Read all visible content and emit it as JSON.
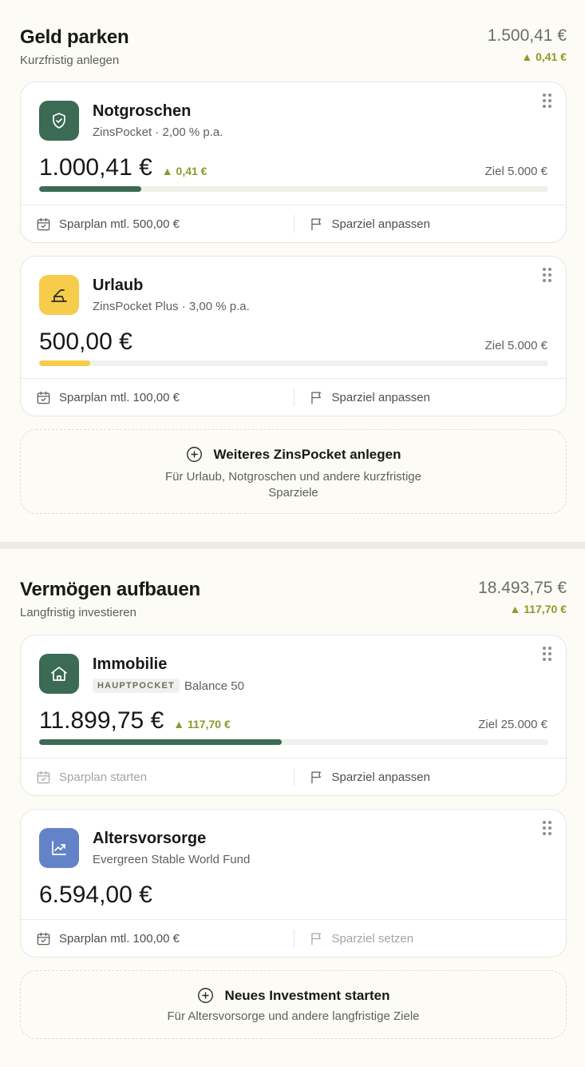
{
  "sections": [
    {
      "title": "Geld parken",
      "subtitle": "Kurzfristig anlegen",
      "total": "1.500,41 €",
      "delta": "▲ 0,41 €",
      "cards": [
        {
          "title": "Notgroschen",
          "subtitle": "ZinsPocket · 2,00 % p.a.",
          "amount": "1.000,41 €",
          "delta": "▲ 0,41 €",
          "goal": "Ziel 5.000 €",
          "progress": 0.2,
          "icon": "shield-check-icon",
          "footer_left": "Sparplan mtl. 500,00 €",
          "footer_right": "Sparziel anpassen"
        },
        {
          "title": "Urlaub",
          "subtitle": "ZinsPocket Plus · 3,00 % p.a.",
          "amount": "500,00 €",
          "goal": "Ziel 5.000 €",
          "progress": 0.1,
          "icon": "deck-chair-icon",
          "footer_left": "Sparplan mtl. 100,00 €",
          "footer_right": "Sparziel anpassen"
        }
      ],
      "add": {
        "title": "Weiteres ZinsPocket anlegen",
        "subtitle_line1": "Für Urlaub, Notgroschen und andere kurzfristige",
        "subtitle_line2": "Sparziele"
      }
    },
    {
      "title": "Vermögen aufbauen",
      "subtitle": "Langfristig investieren",
      "total": "18.493,75 €",
      "delta": "▲ 117,70 €",
      "cards": [
        {
          "title": "Immobilie",
          "tag": "HAUPTPOCKET",
          "subtitle": "Balance 50",
          "amount": "11.899,75 €",
          "delta": "▲ 117,70 €",
          "goal": "Ziel 25.000 €",
          "progress": 0.476,
          "icon": "house-icon",
          "footer_left": "Sparplan starten",
          "footer_right": "Sparziel anpassen"
        },
        {
          "title": "Altersvorsorge",
          "subtitle": "Evergreen Stable World Fund",
          "amount": "6.594,00 €",
          "icon": "trending-up-icon",
          "footer_left": "Sparplan mtl. 100,00 €",
          "footer_right": "Sparziel setzen"
        }
      ],
      "add": {
        "title": "Neues Investment starten",
        "subtitle_line1": "Für Altersvorsorge und andere langfristige Ziele"
      }
    }
  ],
  "colors": {
    "background": "#fdfbf5",
    "dark_green": "#3b6a55",
    "yellow": "#f7cc4a",
    "blue": "#6383c9",
    "delta_green": "#8a9a2c"
  }
}
